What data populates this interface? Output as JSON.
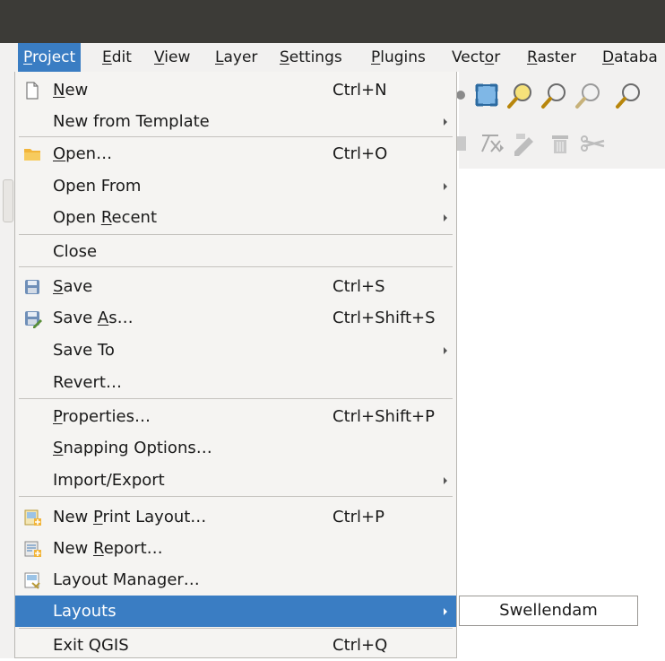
{
  "menubar": {
    "items": [
      {
        "pre": "",
        "u": "P",
        "post": "roject"
      },
      {
        "pre": "",
        "u": "E",
        "post": "dit"
      },
      {
        "pre": "",
        "u": "V",
        "post": "iew"
      },
      {
        "pre": "",
        "u": "L",
        "post": "ayer"
      },
      {
        "pre": "",
        "u": "S",
        "post": "ettings"
      },
      {
        "pre": "",
        "u": "P",
        "post": "lugins"
      },
      {
        "pre": "Vect",
        "u": "o",
        "post": "r"
      },
      {
        "pre": "",
        "u": "R",
        "post": "aster"
      },
      {
        "pre": "",
        "u": "D",
        "post": "ataba"
      }
    ]
  },
  "project_menu": {
    "items": [
      {
        "icon": "new-file-icon",
        "pre": "",
        "u": "N",
        "post": "ew",
        "shortcut": "Ctrl+N",
        "submenu": false
      },
      {
        "icon": "",
        "pre": "New from Template",
        "u": "",
        "post": "",
        "shortcut": "",
        "submenu": true
      },
      {
        "icon": "open-folder-icon",
        "pre": "",
        "u": "O",
        "post": "pen…",
        "shortcut": "Ctrl+O",
        "submenu": false
      },
      {
        "icon": "",
        "pre": "Open From",
        "u": "",
        "post": "",
        "shortcut": "",
        "submenu": true
      },
      {
        "icon": "",
        "pre": "Open ",
        "u": "R",
        "post": "ecent",
        "shortcut": "",
        "submenu": true
      },
      {
        "icon": "",
        "pre": "Close",
        "u": "",
        "post": "",
        "shortcut": "",
        "submenu": false
      },
      {
        "icon": "save-icon",
        "pre": "",
        "u": "S",
        "post": "ave",
        "shortcut": "Ctrl+S",
        "submenu": false
      },
      {
        "icon": "save-as-icon",
        "pre": "Save ",
        "u": "A",
        "post": "s…",
        "shortcut": "Ctrl+Shift+S",
        "submenu": false
      },
      {
        "icon": "",
        "pre": "Save To",
        "u": "",
        "post": "",
        "shortcut": "",
        "submenu": true
      },
      {
        "icon": "",
        "pre": "Revert…",
        "u": "",
        "post": "",
        "shortcut": "",
        "submenu": false
      },
      {
        "icon": "",
        "pre": "",
        "u": "P",
        "post": "roperties…",
        "shortcut": "Ctrl+Shift+P",
        "submenu": false
      },
      {
        "icon": "",
        "pre": "",
        "u": "S",
        "post": "napping Options…",
        "shortcut": "",
        "submenu": false
      },
      {
        "icon": "",
        "pre": "Import/Export",
        "u": "",
        "post": "",
        "shortcut": "",
        "submenu": true
      },
      {
        "icon": "new-print-layout-icon",
        "pre": "New ",
        "u": "P",
        "post": "rint Layout…",
        "shortcut": "Ctrl+P",
        "submenu": false
      },
      {
        "icon": "new-report-icon",
        "pre": "New ",
        "u": "R",
        "post": "eport…",
        "shortcut": "",
        "submenu": false
      },
      {
        "icon": "layout-manager-icon",
        "pre": "Layout Manager…",
        "u": "",
        "post": "",
        "shortcut": "",
        "submenu": false
      },
      {
        "icon": "",
        "pre": "Layouts",
        "u": "",
        "post": "",
        "shortcut": "",
        "submenu": true
      },
      {
        "icon": "",
        "pre": "Exit QGIS",
        "u": "",
        "post": "",
        "shortcut": "Ctrl+Q",
        "submenu": false
      }
    ]
  },
  "layouts_submenu": {
    "items": [
      "Swellendam"
    ]
  },
  "colors": {
    "highlight": "#3a7dc3",
    "titlebar": "#3c3b37",
    "menu_bg": "#f5f4f2"
  }
}
